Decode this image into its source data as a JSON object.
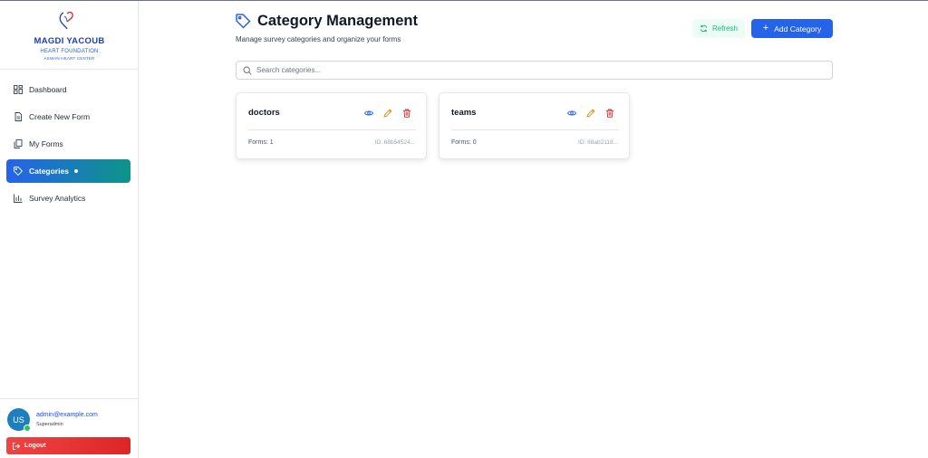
{
  "brand": {
    "name": "MAGDI YACOUB",
    "subtitle": "HEART FOUNDATION",
    "subtitle2": "ASWAN HEART CENTER"
  },
  "sidebar": {
    "items": [
      {
        "label": "Dashboard",
        "icon": "dashboard-icon"
      },
      {
        "label": "Create New Form",
        "icon": "document-icon"
      },
      {
        "label": "My Forms",
        "icon": "copy-icon"
      },
      {
        "label": "Categories",
        "icon": "tag-icon",
        "active": true
      },
      {
        "label": "Survey Analytics",
        "icon": "bar-chart-icon"
      }
    ]
  },
  "user": {
    "initials": "US",
    "email": "admin@example.com",
    "role": "Superadmin",
    "logout_label": "Logout"
  },
  "header": {
    "title": "Category Management",
    "subtitle": "Manage survey categories and organize your forms",
    "refresh_label": "Refresh",
    "add_label": "Add Category"
  },
  "search": {
    "placeholder": "Search categories..."
  },
  "categories": [
    {
      "name": "doctors",
      "forms": "Forms: 1",
      "id": "ID: 68b54524..."
    },
    {
      "name": "teams",
      "forms": "Forms: 0",
      "id": "ID: 68ab2118..."
    }
  ],
  "colors": {
    "primary": "#2563eb",
    "accent_teal": "#0d9488",
    "danger": "#dc2626",
    "success": "#10b981",
    "edit": "#ca8a04"
  }
}
